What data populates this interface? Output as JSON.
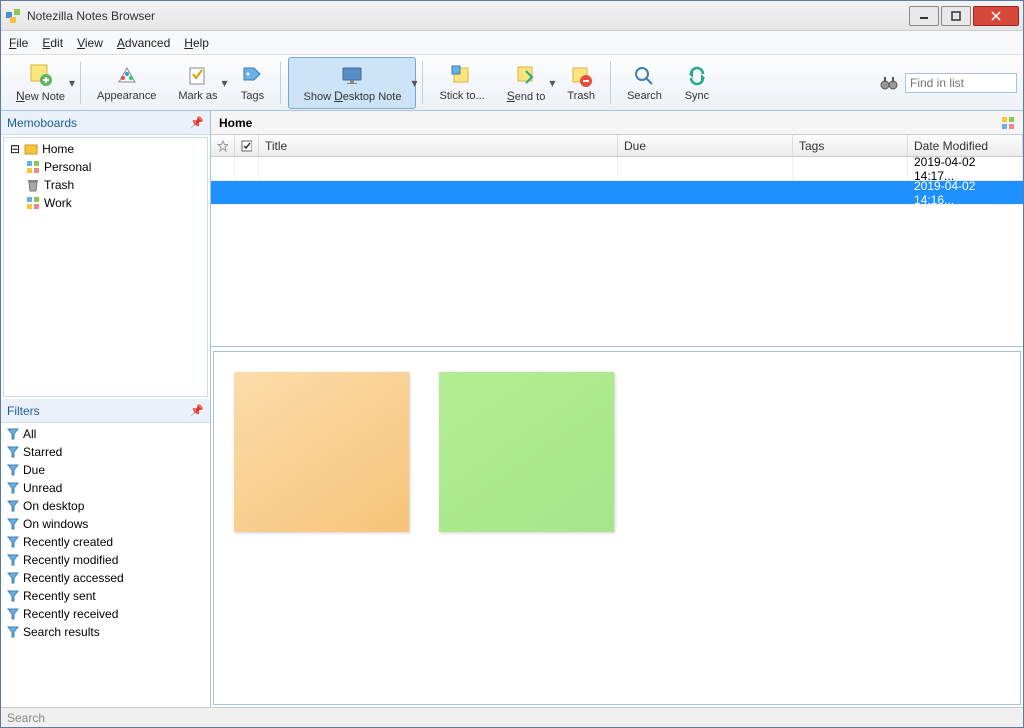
{
  "window": {
    "title": "Notezilla Notes Browser"
  },
  "menu": {
    "file": "File",
    "edit": "Edit",
    "view": "View",
    "advanced": "Advanced",
    "help": "Help"
  },
  "toolbar": {
    "new_note": "New Note",
    "appearance": "Appearance",
    "mark_as": "Mark as",
    "tags": "Tags",
    "show_desktop_note": "Show Desktop Note",
    "stick_to": "Stick to...",
    "send_to": "Send to",
    "trash": "Trash",
    "search": "Search",
    "sync": "Sync",
    "find_placeholder": "Find in list"
  },
  "sidebar": {
    "memoboards_title": "Memoboards",
    "items": [
      {
        "label": "Home"
      },
      {
        "label": "Personal"
      },
      {
        "label": "Trash"
      },
      {
        "label": "Work"
      }
    ],
    "filters_title": "Filters",
    "filters": [
      {
        "label": "All"
      },
      {
        "label": "Starred"
      },
      {
        "label": "Due"
      },
      {
        "label": "Unread"
      },
      {
        "label": "On desktop"
      },
      {
        "label": "On windows"
      },
      {
        "label": "Recently created"
      },
      {
        "label": "Recently modified"
      },
      {
        "label": "Recently accessed"
      },
      {
        "label": "Recently sent"
      },
      {
        "label": "Recently received"
      },
      {
        "label": "Search results"
      }
    ]
  },
  "main": {
    "location": "Home",
    "columns": {
      "title": "Title",
      "due": "Due",
      "tags": "Tags",
      "date": "Date Modified"
    },
    "rows": [
      {
        "title": "",
        "due": "",
        "tags": "",
        "date": "2019-04-02 14:17...",
        "selected": false
      },
      {
        "title": "",
        "due": "",
        "tags": "",
        "date": "2019-04-02 14:16...",
        "selected": true
      }
    ]
  },
  "statusbar": {
    "search": "Search"
  }
}
